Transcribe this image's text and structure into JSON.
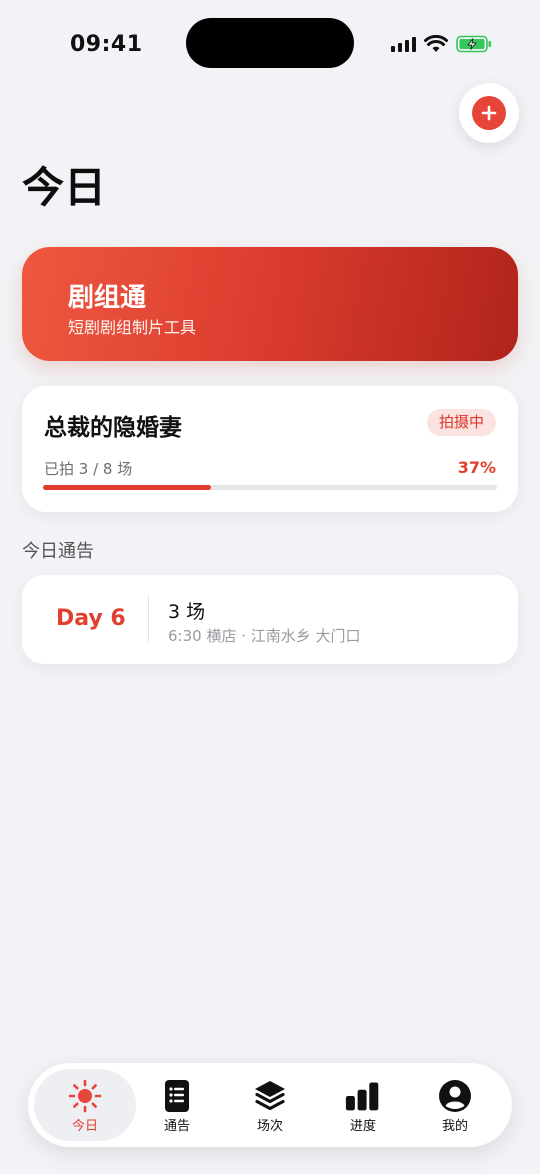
{
  "status_bar": {
    "time": "09:41"
  },
  "header": {
    "title": "今日",
    "add_icon": "plus-circle-icon"
  },
  "hero": {
    "title": "剧组通",
    "subtitle": "短剧剧组制片工具"
  },
  "project": {
    "title": "总裁的隐婚妻",
    "status": "拍摄中",
    "progress_label": "已拍 3 / 8 场",
    "progress_percent": "37%",
    "progress_value": 0.37
  },
  "notice_section": {
    "title": "今日通告",
    "items": [
      {
        "day": "Day 6",
        "scenes": "3 场",
        "detail": "6:30  横店 · 江南水乡 大门口"
      }
    ]
  },
  "tab_bar": {
    "items": [
      {
        "label": "今日",
        "icon": "sun-icon",
        "active": true
      },
      {
        "label": "通告",
        "icon": "notice-list-icon",
        "active": false
      },
      {
        "label": "场次",
        "icon": "layers-icon",
        "active": false
      },
      {
        "label": "进度",
        "icon": "bar-chart-icon",
        "active": false
      },
      {
        "label": "我的",
        "icon": "user-circle-icon",
        "active": false
      }
    ]
  },
  "colors": {
    "accent": "#e0402f",
    "background": "#f2f3f6"
  }
}
